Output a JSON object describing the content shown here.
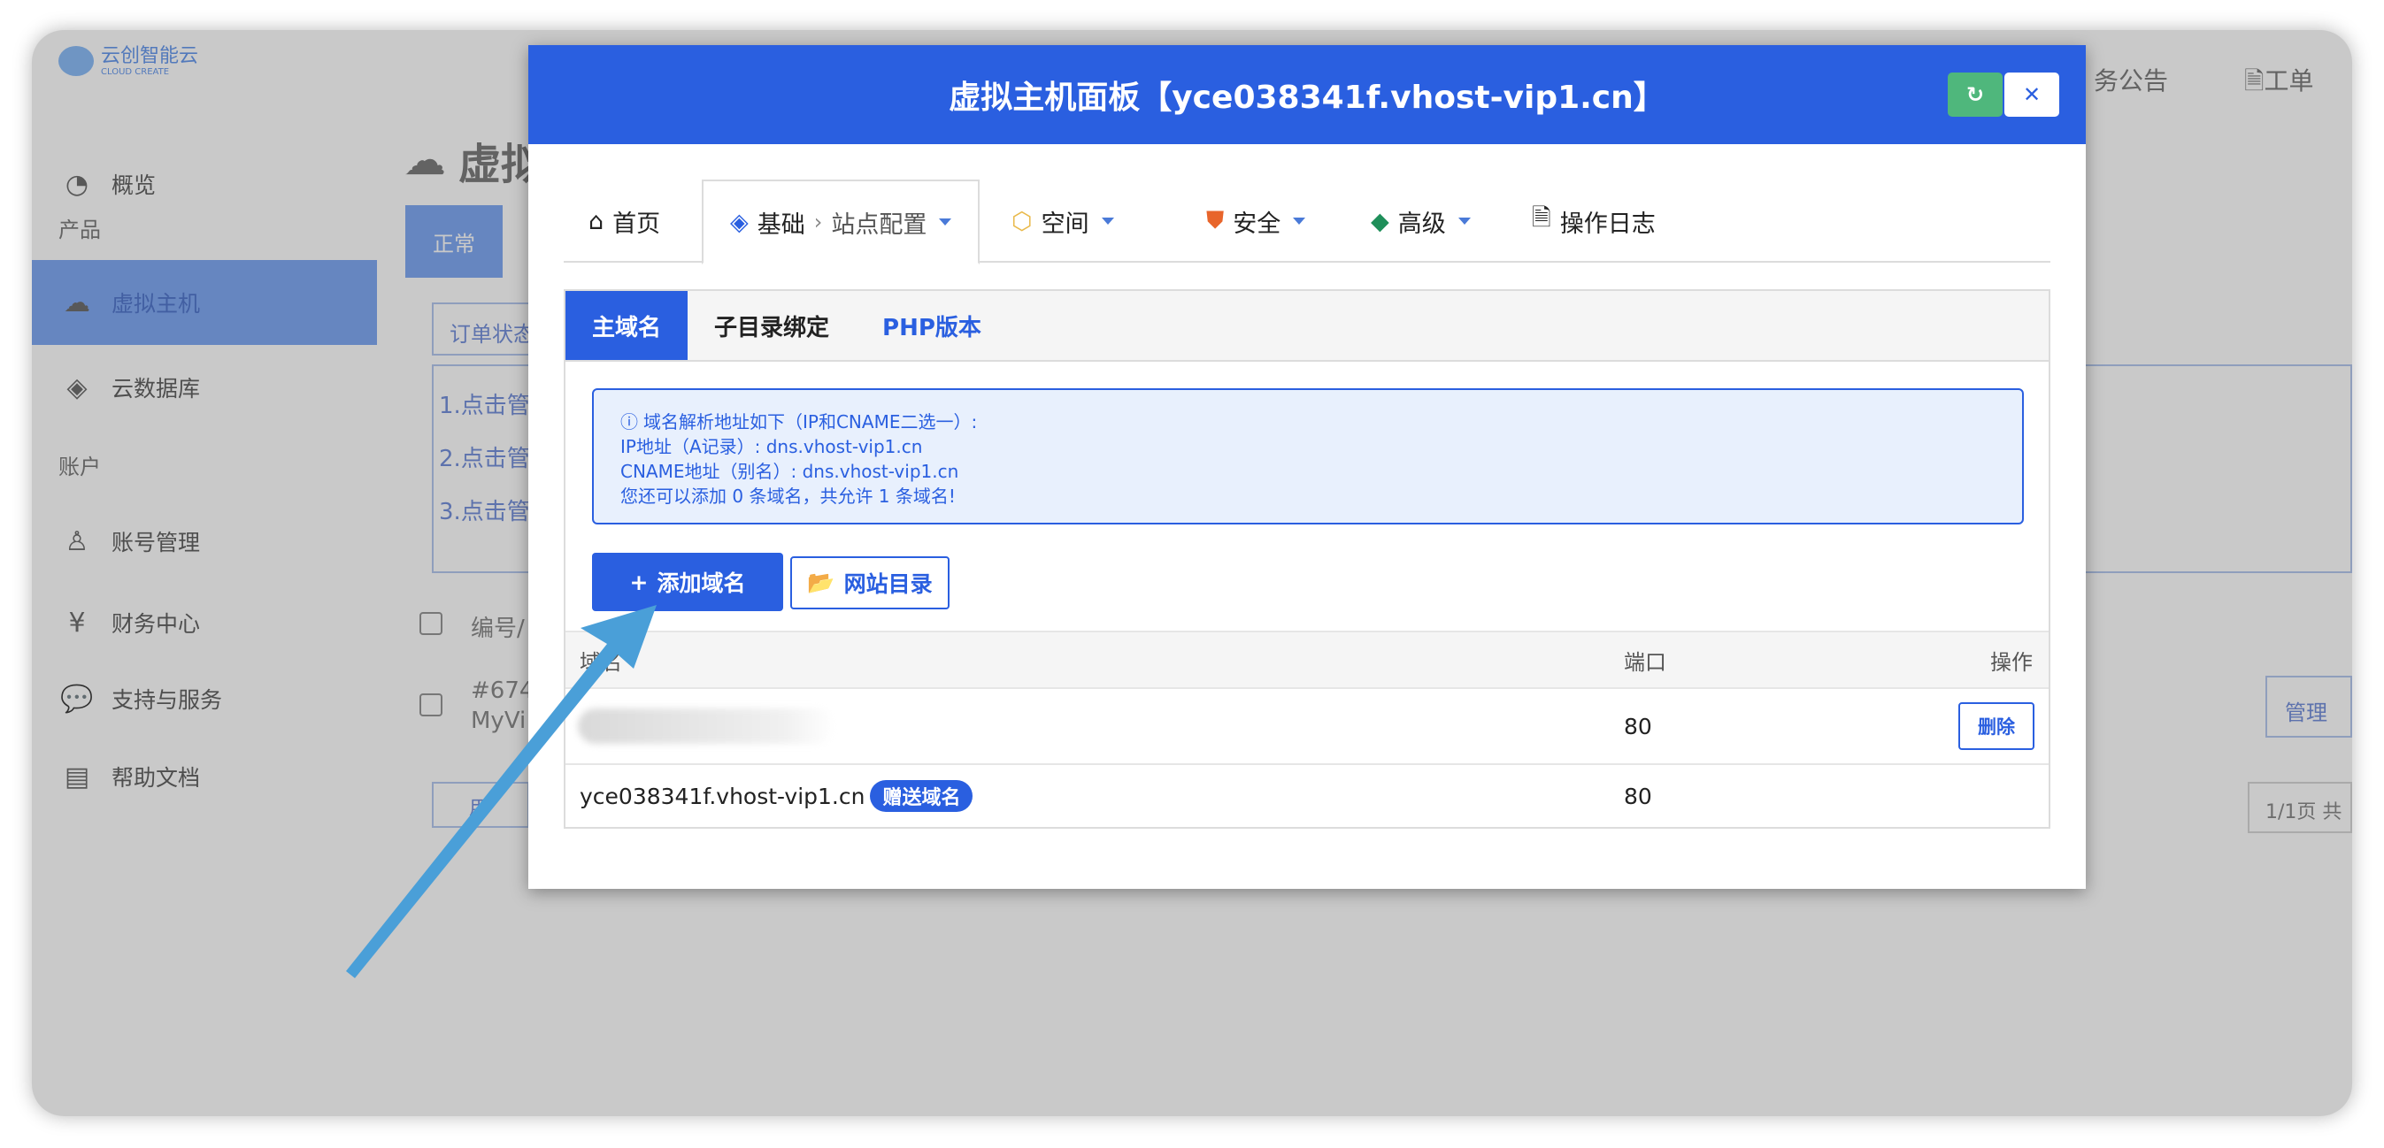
{
  "background": {
    "logo_text": "云创智能云",
    "logo_sub": "CLOUD CREATE",
    "top_links": [
      "务公告",
      "工单"
    ],
    "sidebar": {
      "items": [
        {
          "label": "概览",
          "icon": "dashboard-icon"
        },
        {
          "label": "虚拟主机",
          "icon": "cloud-icon"
        },
        {
          "label": "云数据库",
          "icon": "layers-icon"
        },
        {
          "label": "账号管理",
          "icon": "user-icon"
        },
        {
          "label": "财务中心",
          "icon": "yen-icon"
        },
        {
          "label": "支持与服务",
          "icon": "chat-icon"
        },
        {
          "label": "帮助文档",
          "icon": "doc-icon"
        }
      ],
      "groups": [
        "产品",
        "账户"
      ]
    },
    "page_title": "虚拟",
    "status_tab": "正常",
    "filter_placeholder": "订单状态",
    "steps": [
      "1.点击管",
      "2.点击管",
      "3.点击管"
    ],
    "col_head": "编号/",
    "row_id": "#674",
    "row_name": "MyVi",
    "batch_label": "用",
    "manage_label": "管理",
    "pagination": "1/1页 共"
  },
  "modal": {
    "title": "虚拟主机面板【yce038341f.vhost-vip1.cn】",
    "tabs": [
      {
        "label": "首页",
        "icon": "home-icon"
      },
      {
        "label": "基础",
        "sub": "站点配置",
        "icon": "layers-icon"
      },
      {
        "label": "空间",
        "icon": "box-icon"
      },
      {
        "label": "安全",
        "icon": "shield-icon"
      },
      {
        "label": "高级",
        "icon": "diamond-icon"
      },
      {
        "label": "操作日志",
        "icon": "file-icon"
      }
    ],
    "subtabs": [
      "主域名",
      "子目录绑定",
      "PHP版本"
    ],
    "info": {
      "line1": "域名解析地址如下（IP和CNAME二选一）:",
      "line2": "IP地址（A记录）: dns.vhost-vip1.cn",
      "line3": "CNAME地址（别名）: dns.vhost-vip1.cn",
      "line4": "您还可以添加 0 条域名，共允许 1 条域名!"
    },
    "add_domain_label": "添加域名",
    "site_dir_label": "网站目录",
    "table": {
      "headers": [
        "域名",
        "端口",
        "操作"
      ],
      "rows": [
        {
          "domain": "",
          "port": "80",
          "action": "删除"
        },
        {
          "domain": "yce038341f.vhost-vip1.cn",
          "badge": "赠送域名",
          "port": "80",
          "action": ""
        }
      ]
    }
  },
  "colors": {
    "primary": "#2a5fe0",
    "success": "#4fb77c",
    "arrow": "#4a9fd8"
  }
}
